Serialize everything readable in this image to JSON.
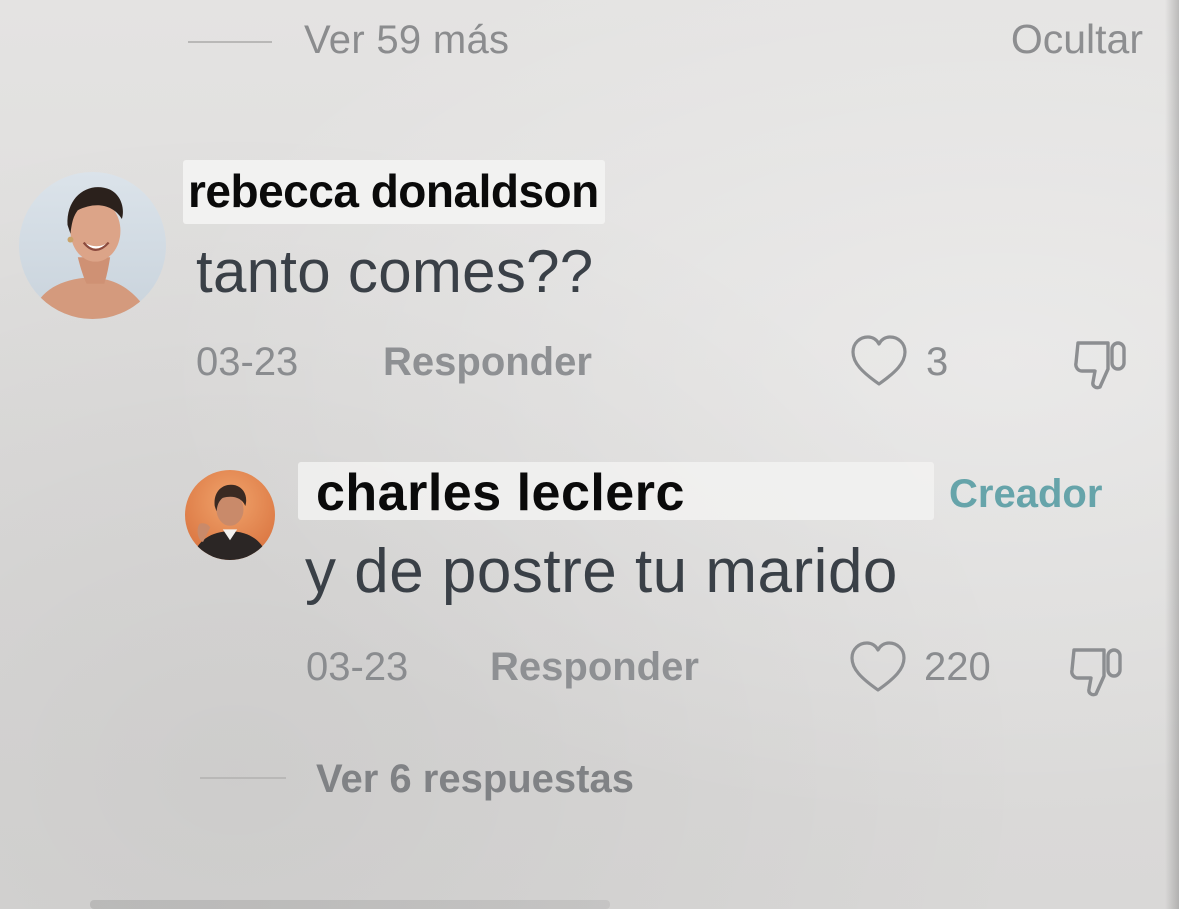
{
  "thread": {
    "see_more_label": "Ver 59 más",
    "hide_label": "Ocultar"
  },
  "comments": [
    {
      "author": "rebecca donaldson",
      "text": "tanto comes??",
      "date": "03-23",
      "reply_label": "Responder",
      "likes": "3",
      "avatar_icon": "user-avatar-photo"
    },
    {
      "author": "charles leclerc",
      "badge": "Creador",
      "text": "y de postre tu marido",
      "date": "03-23",
      "reply_label": "Responder",
      "likes": "220",
      "avatar_icon": "user-avatar-photo"
    }
  ],
  "replies": {
    "view_replies_label": "Ver 6 respuestas"
  },
  "colors": {
    "background": "#dfdedd",
    "text_primary": "#3a4047",
    "text_muted": "#8a8c8f",
    "creator_badge": "#66a4aa"
  },
  "icons": {
    "like": "heart-outline-icon",
    "dislike": "thumbs-down-outline-icon"
  }
}
